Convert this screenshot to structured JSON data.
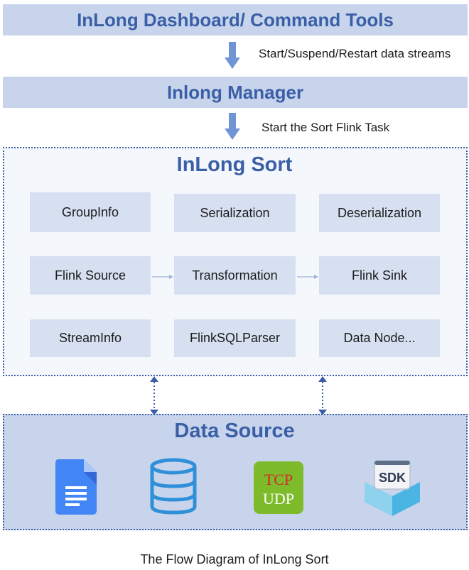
{
  "header": {
    "title": "InLong Dashboard/ Command Tools"
  },
  "arrow1": {
    "label": "Start/Suspend/Restart data streams"
  },
  "manager": {
    "title": "Inlong Manager"
  },
  "arrow2": {
    "label": "Start the Sort Flink Task"
  },
  "sort": {
    "title": "InLong Sort",
    "row1": [
      "GroupInfo",
      "Serialization",
      "Deserialization"
    ],
    "row2": [
      "Flink Source",
      "Transformation",
      "Flink Sink"
    ],
    "row3": [
      "StreamInfo",
      "FlinkSQLParser",
      "Data Node..."
    ]
  },
  "source": {
    "title": "Data Source",
    "icons": [
      "document-icon",
      "database-icon",
      "tcp-udp-icon",
      "sdk-icon"
    ],
    "tcp_label": "TCP",
    "udp_label": "UDP",
    "sdk_label": "SDK"
  },
  "caption": "The Flow Diagram of InLong Sort",
  "colors": {
    "accent": "#3a5fa6",
    "bar_fill": "#c7d4ec",
    "box_fill": "#d6e0f1",
    "arrow": "#6f95d6",
    "doc_blue": "#4285f4",
    "db_blue": "#2f8fd8",
    "tcp_green": "#7dbb2b",
    "tcp_red": "#d8262b",
    "sdk_blue": "#4ab5e3"
  }
}
